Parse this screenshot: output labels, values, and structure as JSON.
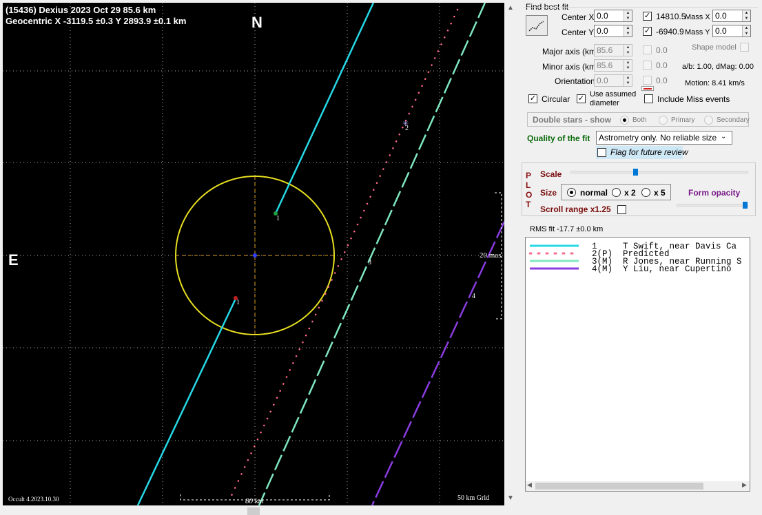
{
  "plot": {
    "title_line1": "(15436) Dexius  2023 Oct 29  85.6 km",
    "title_line2": "Geocentric  X  -3119.5 ±0.3  Y 2893.9 ±0.1 km",
    "north_label": "N",
    "east_label": "E",
    "scale_bar_label": "20 mas",
    "bottom_bar_label": "80 km",
    "grid_label": "50 km Grid",
    "version_label": "Occult 4.2023.10.30",
    "chord_labels": [
      "1",
      "1",
      "2",
      "3",
      "4"
    ],
    "colors": {
      "background": "#000000",
      "ellipse": "#e8e020",
      "chord1": "#26d9e6",
      "predicted": "#ff6b8a",
      "chord3": "#7fe8c0",
      "chord4": "#8a3ce0",
      "grid": "#b0b0b0"
    }
  },
  "panel": {
    "find_best_fit_label": "Find best fit",
    "center_x_label": "Center X",
    "center_x_value": "0.0",
    "center_y_label": "Center Y",
    "center_y_value": "0.0",
    "mass_x_value_label": "14810.5",
    "mass_x_label": "Mass X",
    "mass_x_value": "0.0",
    "mass_y_value_label": "-6940.9",
    "mass_y_label": "Mass Y",
    "mass_y_value": "0.0",
    "major_axis_label": "Major axis (km)",
    "major_axis_value": "85.6",
    "minor_axis_label": "Minor axis (km)",
    "minor_axis_value": "85.6",
    "orientation_label": "Orientation",
    "orientation_value": "0.0",
    "major_uncert": "0.0",
    "minor_uncert": "0.0",
    "orient_uncert": "0.0",
    "shape_model_label": "Shape model",
    "ab_label": "a/b: 1.00, dMag: 0.00",
    "motion_label": "Motion: 8.41 km/s",
    "circular_label": "Circular",
    "use_assumed_label_1": "Use assumed",
    "use_assumed_label_2": "diameter",
    "include_miss_label": "Include Miss events",
    "double_stars_label": "Double stars - show",
    "both_label": "Both",
    "primary_label": "Primary",
    "secondary_label": "Secondary",
    "quality_label": "Quality of the fit",
    "quality_value": "Astrometry only. No reliable size",
    "flag_label": "Flag for future review",
    "plot_vertical": [
      "P",
      "L",
      "O",
      "T"
    ],
    "scale_label": "Scale",
    "size_label": "Size",
    "size_normal": "normal",
    "size_x2": "x 2",
    "size_x5": "x 5",
    "form_opacity_label": "Form opacity",
    "scroll_range_label": "Scroll range x1.25",
    "rms_label": "RMS fit -17.7 ±0.0 km",
    "legend": [
      {
        "text": "1     T Swift, near Davis Ca",
        "color": "#26d9e6",
        "style": "solid"
      },
      {
        "text": "2(P)  Predicted",
        "color": "#ff6b8a",
        "style": "dotted"
      },
      {
        "text": "3(M)  R Jones, near Running S",
        "color": "#7fe8c0",
        "style": "solid"
      },
      {
        "text": "4(M)  Y Liu, near Cupertino",
        "color": "#8a3ce0",
        "style": "solid"
      }
    ]
  }
}
